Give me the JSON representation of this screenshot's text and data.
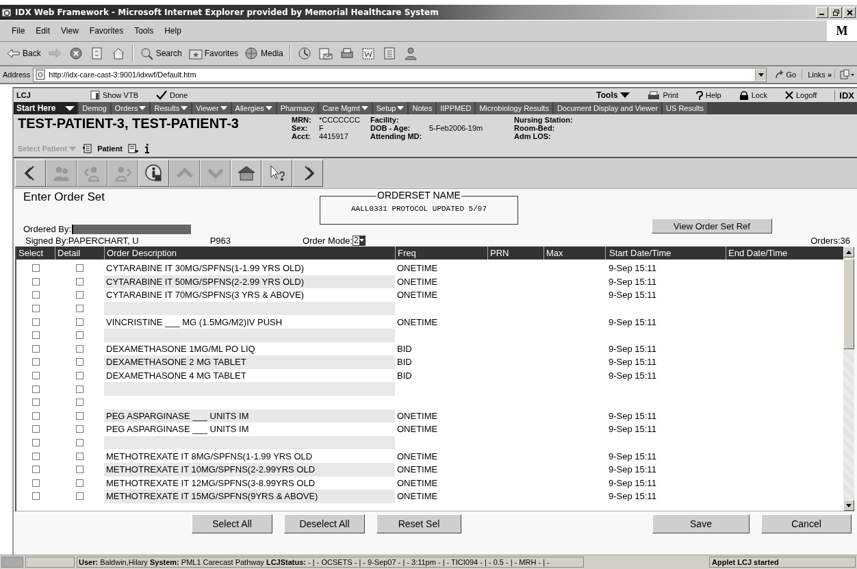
{
  "window": {
    "title": "IDX Web Framework - Microsoft Internet Explorer provided by Memorial Healthcare System"
  },
  "menu": [
    "File",
    "Edit",
    "View",
    "Favorites",
    "Tools",
    "Help"
  ],
  "brand": "M",
  "toolbar": [
    {
      "kind": "back",
      "label": "Back"
    },
    {
      "kind": "forward"
    },
    {
      "kind": "stop"
    },
    {
      "kind": "refresh"
    },
    {
      "kind": "home"
    },
    {
      "kind": "search",
      "label": "Search"
    },
    {
      "kind": "favorites",
      "label": "Favorites"
    },
    {
      "kind": "media",
      "label": "Media"
    },
    {
      "kind": "history"
    },
    {
      "kind": "mail"
    },
    {
      "kind": "print"
    },
    {
      "kind": "word"
    },
    {
      "kind": "page"
    },
    {
      "kind": "messenger"
    }
  ],
  "address": {
    "label": "Address",
    "value": "http://idx-care-cast-3:9001/idxwf/Default.htm",
    "go": "Go",
    "links": "Links",
    "links_more": "»"
  },
  "app_bar": {
    "app": "LCJ",
    "left": [
      {
        "kind": "vtb",
        "label": "Show VTB"
      },
      {
        "kind": "done",
        "label": "Done"
      }
    ],
    "tools": "Tools",
    "right": [
      {
        "kind": "print",
        "label": "Print"
      },
      {
        "kind": "help",
        "label": "Help"
      },
      {
        "kind": "lock",
        "label": "Lock"
      },
      {
        "kind": "logoff",
        "label": "Logoff"
      }
    ],
    "logo": "IDX"
  },
  "tabs": [
    {
      "label": "Start Here",
      "selected": true,
      "menu": true
    },
    {
      "label": "Demog",
      "selected": false,
      "menu": false
    },
    {
      "label": "Orders",
      "selected": false,
      "menu": true
    },
    {
      "label": "Results",
      "selected": false,
      "menu": true
    },
    {
      "label": "Viewer",
      "selected": false,
      "menu": true
    },
    {
      "label": "Allergies",
      "selected": false,
      "menu": true
    },
    {
      "label": "Pharmacy",
      "selected": false,
      "menu": false
    },
    {
      "label": "Care Mgmt",
      "selected": false,
      "menu": true
    },
    {
      "label": "Setup",
      "selected": false,
      "menu": true
    },
    {
      "label": "Notes",
      "selected": false,
      "menu": false
    },
    {
      "label": "IIPPMED",
      "selected": false,
      "menu": false
    },
    {
      "label": "Microbiology Results",
      "selected": false,
      "menu": false
    },
    {
      "label": "Document Display and Viewer",
      "selected": false,
      "menu": false
    },
    {
      "label": "US Results",
      "selected": false,
      "menu": false
    }
  ],
  "patient": {
    "name": "TEST-PATIENT-3, TEST-PATIENT-3",
    "select_patient": "Select Patient",
    "patient_link": "Patient",
    "columns": [
      [
        {
          "label": "MRN:",
          "value": "*CCCCCCC"
        },
        {
          "label": "Sex:",
          "value": "F"
        },
        {
          "label": "Acct:",
          "value": "4415917"
        }
      ],
      [
        {
          "label": "Facility:"
        },
        {
          "label": "DOB - Age:",
          "value": "5-Feb2006-19m"
        },
        {
          "label": "Attending MD:"
        }
      ],
      [
        {
          "label": "Nursing Station:"
        },
        {
          "label": "Room-Bed:"
        },
        {
          "label": "Adm LOS:"
        }
      ]
    ]
  },
  "nav_buttons": [
    {
      "kind": "first",
      "disabled": false
    },
    {
      "kind": "people",
      "disabled": true
    },
    {
      "kind": "prev-person",
      "disabled": true
    },
    {
      "kind": "next-person",
      "disabled": true
    },
    {
      "kind": "info",
      "disabled": false
    },
    {
      "kind": "up",
      "disabled": true
    },
    {
      "kind": "down",
      "disabled": true
    },
    {
      "kind": "home",
      "disabled": false
    },
    {
      "kind": "help",
      "disabled": false
    },
    {
      "kind": "last",
      "disabled": false
    }
  ],
  "order_set": {
    "heading": "Enter Order Set",
    "box_title": "ORDERSET NAME",
    "name": "AALL0331 PROTOCOL UPDATED 5/07",
    "ordered_by": "Ordered By:",
    "signed_by": "Signed By:PAPERCHART, U",
    "code": "P963",
    "order_mode": "Order Mode:",
    "mode_value": "2",
    "view_ref": "View Order Set Ref",
    "orders": "Orders:36"
  },
  "table": {
    "columns": [
      "Select",
      "Detail",
      "Order Description",
      "Freq",
      "PRN",
      "Max",
      "Start Date/Time",
      "End Date/Time"
    ],
    "rows": [
      {
        "select": false,
        "detail": false,
        "description": "CYTARABINE IT 30MG/SPFNS(1-1.99 YRS OLD)",
        "freq": "ONETIME",
        "start": "9-Sep  15:11"
      },
      {
        "select": false,
        "detail": false,
        "description": "CYTARABINE IT 50MG/SPFNS(2-2.99 YRS OLD)",
        "freq": "ONETIME",
        "start": "9-Sep  15:11"
      },
      {
        "select": false,
        "detail": false,
        "description": "CYTARABINE IT 70MG/SPFNS(3 YRS & ABOVE)",
        "freq": "ONETIME",
        "start": "9-Sep  15:11"
      },
      {
        "select": false,
        "detail": false
      },
      {
        "select": false,
        "detail": false,
        "description": "VINCRISTINE ___ MG (1.5MG/M2)IV PUSH",
        "freq": "ONETIME",
        "start": "9-Sep  15:11"
      },
      {
        "select": false,
        "detail": false
      },
      {
        "select": false,
        "detail": false,
        "description": "DEXAMETHASONE 1MG/ML PO LIQ",
        "freq": "BID",
        "start": "9-Sep  15:11"
      },
      {
        "select": false,
        "detail": false,
        "description": "DEXAMETHASONE 2 MG TABLET",
        "freq": "BID",
        "start": "9-Sep  15:11"
      },
      {
        "select": false,
        "detail": false,
        "description": "DEXAMETHASONE 4 MG TABLET",
        "freq": "BID",
        "start": "9-Sep  15:11"
      },
      {
        "select": false,
        "detail": false
      },
      {
        "select": false,
        "detail": false
      },
      {
        "select": false,
        "detail": false,
        "description": "PEG ASPARGINASE ___ UNITS IM",
        "freq": "ONETIME",
        "start": "9-Sep  15:11"
      },
      {
        "select": false,
        "detail": false,
        "description": "PEG ASPARGINASE ___ UNITS IM",
        "freq": "ONETIME",
        "start": "9-Sep  15:11"
      },
      {
        "select": false,
        "detail": false
      },
      {
        "select": false,
        "detail": false,
        "description": "METHOTREXATE IT 8MG/SPFNS(1-1.99 YRS OLD",
        "freq": "ONETIME",
        "start": "9-Sep  15:11"
      },
      {
        "select": false,
        "detail": false,
        "description": "METHOTREXATE IT 10MG/SPFNS(2-2.99YRS OLD",
        "freq": "ONETIME",
        "start": "9-Sep  15:11"
      },
      {
        "select": false,
        "detail": false,
        "description": "METHOTREXATE IT 12MG/SPFNS(3-8.99YRS OLD",
        "freq": "ONETIME",
        "start": "9-Sep  15:11"
      },
      {
        "select": false,
        "detail": false,
        "description": "METHOTREXATE IT 15MG/SPFNS(9YRS & ABOVE)",
        "freq": "ONETIME",
        "start": "9-Sep  15:11"
      }
    ]
  },
  "buttons": [
    "Select All",
    "Deselect All",
    "Reset Sel",
    "Save",
    "Cancel"
  ],
  "status_bar": {
    "text": "**User:** Baldwin,Hilary  **System:** PML1 Carecast Pathway  **LCJStatus:** - | - OCSETS - | - 9-Sep07 - | - 3:11pm - | - TICI094 - | - 0.5 - | - MRH - | -",
    "applet": "Applet LCJ started"
  }
}
